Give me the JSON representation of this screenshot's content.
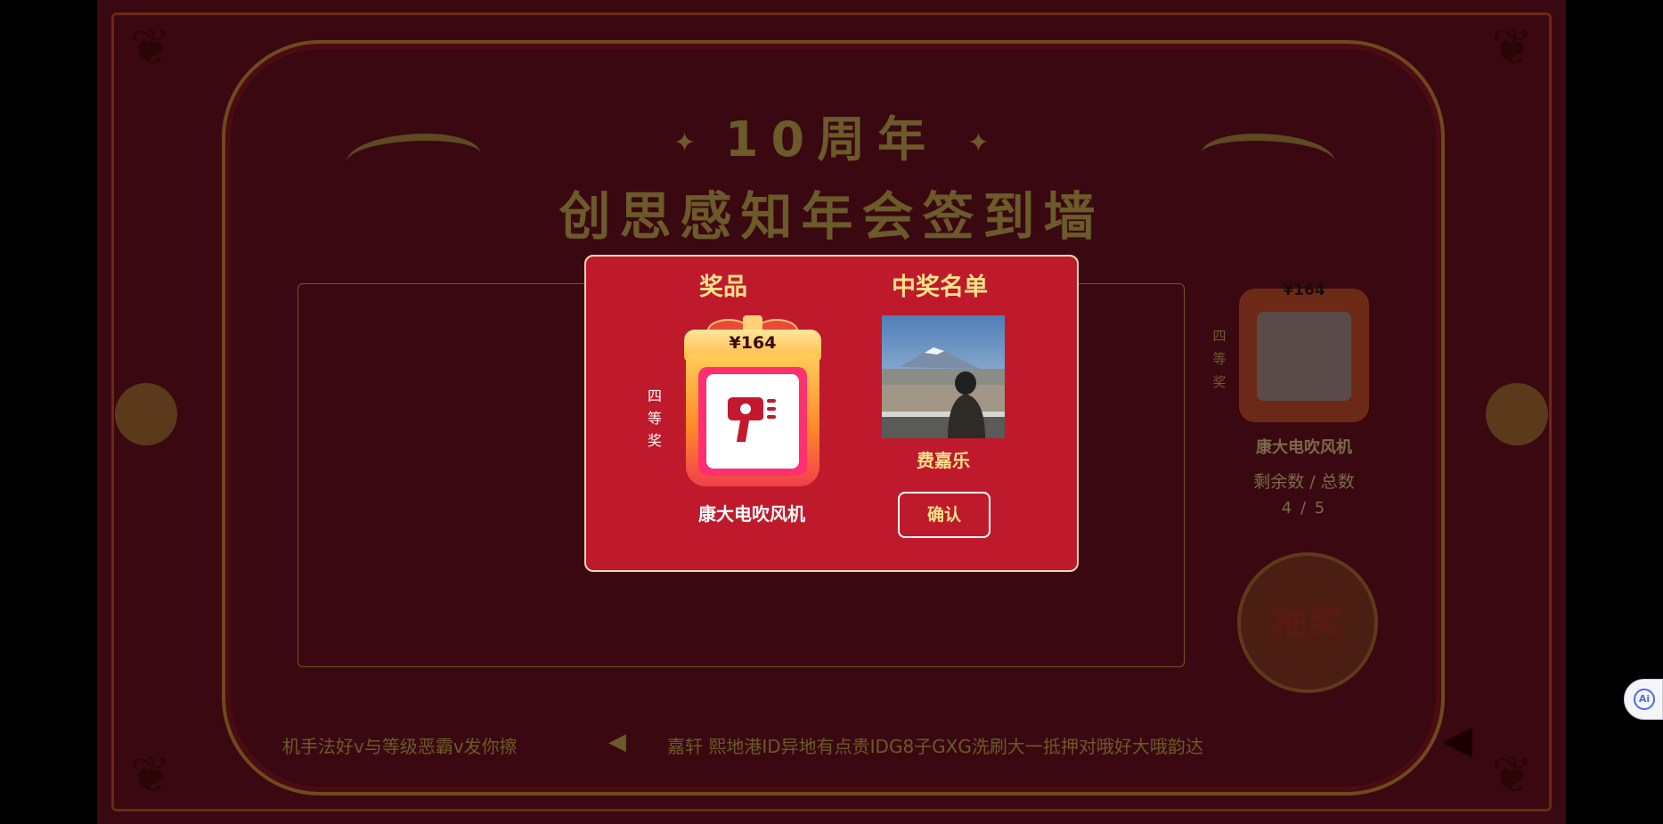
{
  "colors": {
    "page_background": "#3a0810",
    "modal_background": "#be1a2b",
    "modal_border": "#f5d8b0",
    "gold_text": "#ffe18c",
    "muted_gold": "#6b5a2a",
    "gift_pink": "#ff2f70",
    "ai_blue": "#4a6cf0"
  },
  "background": {
    "title_line1": "10周年",
    "title_line2": "创思感知年会签到墙",
    "title_sparkle": "✦",
    "prize_panel": {
      "price": "¥164",
      "tier": [
        "四",
        "等",
        "奖"
      ],
      "name": "康大电吹风机",
      "count_label": "剩余数 / 总数",
      "count_value": "4 / 5"
    },
    "draw_button": "抽奖",
    "ticker": {
      "left_text": "机手法好v与等级恶霸v发你擦",
      "speaker_icon": "speaker-icon",
      "right_text": "嘉轩  熙地港ID异地有点贵IDG8子GXG洗刷大一抵押对哦好大哦韵达"
    },
    "mute_icon": "mute-icon",
    "ai_label": "Ai"
  },
  "modal": {
    "prize_header": "奖品",
    "winner_header": "中奖名单",
    "prize_tier": [
      "四",
      "等",
      "奖"
    ],
    "prize_price": "¥164",
    "prize_icon": "hair-dryer-icon",
    "prize_name": "康大电吹风机",
    "winner_name": "费嘉乐",
    "confirm_label": "确认"
  }
}
